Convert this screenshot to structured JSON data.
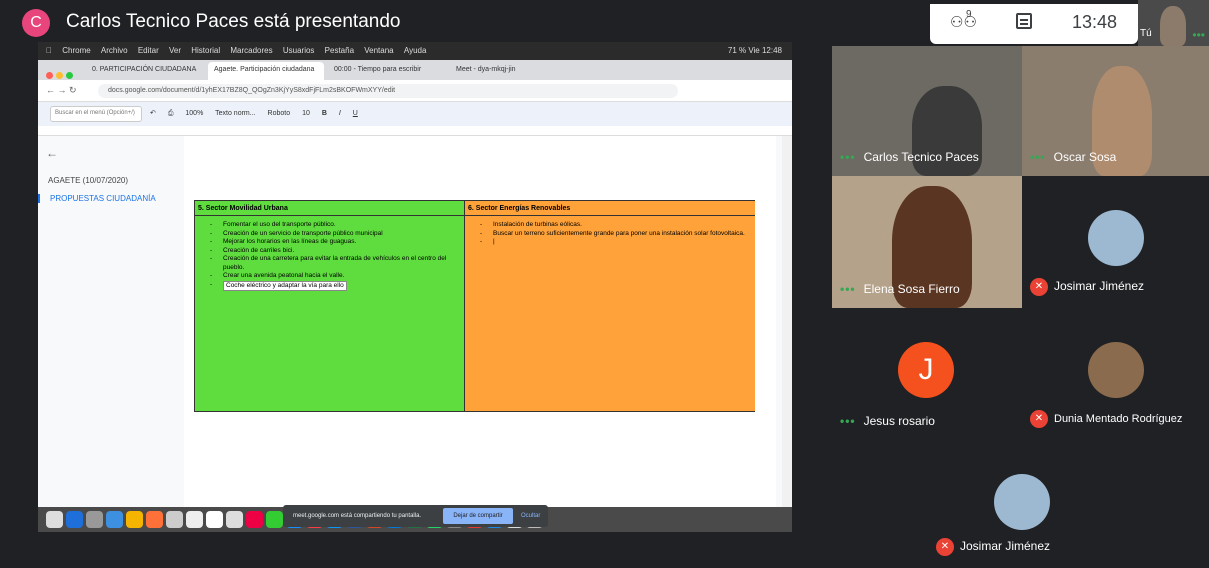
{
  "meet": {
    "presenter_initial": "C",
    "presenter_title": "Carlos Tecnico Paces está presentando",
    "people_count": "9",
    "clock": "13:48",
    "self_label": "Tú"
  },
  "mac_menu": [
    "Chrome",
    "Archivo",
    "Editar",
    "Ver",
    "Historial",
    "Marcadores",
    "Usuarios",
    "Pestaña",
    "Ventana",
    "Ayuda"
  ],
  "mac_status": "71 %  Vie 12:48",
  "tabs": [
    "0. PARTICIPACIÓN CIUDADANA",
    "Agaete. Participación ciudadana",
    "00:00 - Tiempo para escribir",
    "Meet - dya-mkqj-jin"
  ],
  "url": "docs.google.com/document/d/1yhEX17BZ8Q_QOgZn3KjYyS8xdFjFLm2sBKOFWmXYY/edit",
  "toolbar": {
    "search_placeholder": "Buscar en el menú (Opción+/)",
    "zoom": "100%",
    "style": "Texto norm...",
    "font": "Roboto",
    "size": "10"
  },
  "outline": {
    "title": "AGAETE (10/07/2020)",
    "item": "PROPUESTAS CIUDADANÍA"
  },
  "table": {
    "left_header": "5. Sector Movilidad Urbana",
    "left_items": [
      "Fomentar el uso del transporte público.",
      "Creación de un servicio de transporte público municipal",
      "Mejorar los horarios en las líneas de guaguas.",
      "Creación de carriles bici.",
      "Creación de una carretera para evitar la entrada de vehículos en el centro del pueblo.",
      "Crear una avenida peatonal hacia el valle."
    ],
    "left_selected": "Coche eléctrico y adaptar la vía para ello",
    "right_header": "6. Sector Energías Renovables",
    "right_items": [
      "Instalación de turbinas eólicas.",
      "Buscar un terreno suficientemente grande para poner una instalación solar fotovoltaica."
    ]
  },
  "share_banner": {
    "text": "meet.google.com está compartiendo tu pantalla.",
    "stop": "Dejar de compartir",
    "hide": "Ocultar"
  },
  "participants": [
    {
      "name": "Carlos Tecnico Paces"
    },
    {
      "name": "Oscar Sosa"
    },
    {
      "name": "Elena Sosa Fierro"
    },
    {
      "name": "Josimar Jiménez"
    },
    {
      "name": "Jesus rosario",
      "initial": "J"
    },
    {
      "name": "Dunia Mentado Rodríguez"
    },
    {
      "name": "Josimar Jiménez"
    }
  ],
  "colors": {
    "green_column": "#5fdd3f",
    "orange_column": "#ffa23a",
    "avatar_pink": "#e8457c",
    "avatar_orange": "#f4511e",
    "mic_off_red": "#ea4335"
  }
}
